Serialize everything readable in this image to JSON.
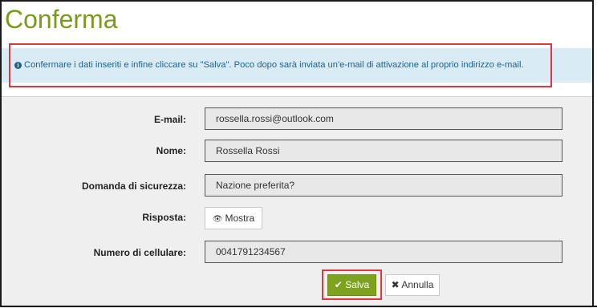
{
  "page": {
    "title": "Conferma"
  },
  "info": {
    "icon": "info-circle-icon",
    "message": "Confermare i dati inseriti e infine cliccare su \"Salva\". Poco dopo sarà inviata un'e-mail di attivazione al proprio indirizzo e-mail."
  },
  "form": {
    "email": {
      "label": "E-mail:",
      "value": "rossella.rossi@outlook.com"
    },
    "name": {
      "label": "Nome:",
      "value": "Rossella Rossi"
    },
    "security_question": {
      "label": "Domanda di sicurezza:",
      "value": "Nazione preferita?"
    },
    "answer": {
      "label": "Risposta:",
      "button_label": "Mostra",
      "icon": "eye-icon"
    },
    "mobile": {
      "label": "Numero di cellulare:",
      "value": "0041791234567"
    }
  },
  "actions": {
    "save_label": "Salva",
    "save_icon": "check-icon",
    "cancel_label": "Annulla",
    "cancel_icon": "x-icon"
  },
  "colors": {
    "accent": "#7fa21e",
    "title": "#7a9a1c",
    "info_bg": "#d9ecf5",
    "highlight": "#e0373f"
  }
}
